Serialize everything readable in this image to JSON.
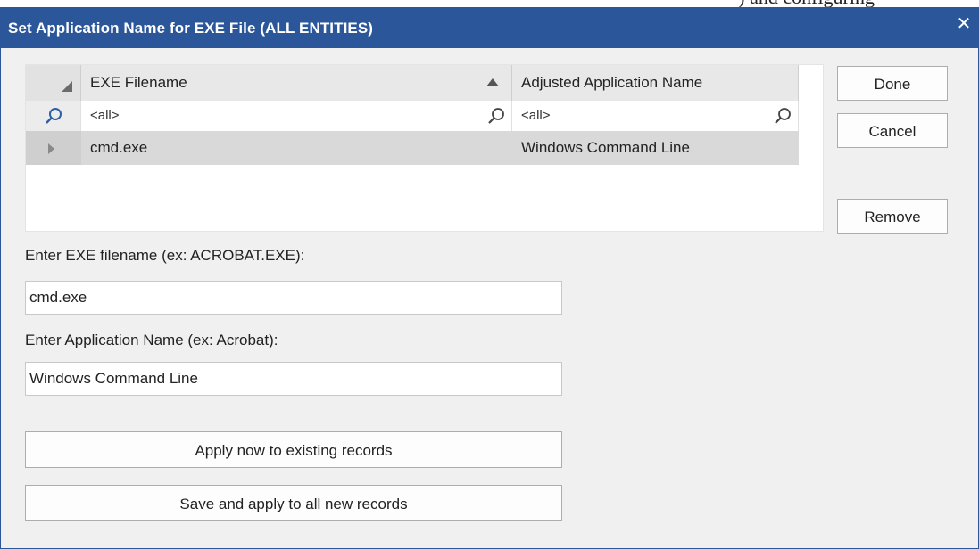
{
  "background_fragment": ") and configuring",
  "titlebar": {
    "title": "Set Application Name for EXE File (ALL ENTITIES)",
    "close_glyph": "✕",
    "color": "#2b579a"
  },
  "grid": {
    "columns": [
      {
        "label": "EXE Filename",
        "sort": "ascending"
      },
      {
        "label": "Adjusted Application Name"
      }
    ],
    "filters": [
      "<all>",
      "<all>"
    ],
    "rows": [
      {
        "exe": "cmd.exe",
        "app_name": "Windows Command Line"
      }
    ]
  },
  "side_buttons": {
    "done": "Done",
    "cancel": "Cancel",
    "remove": "Remove"
  },
  "form": {
    "exe_label": "Enter EXE filename (ex: ACROBAT.EXE):",
    "exe_value": "cmd.exe",
    "app_label": "Enter Application Name (ex: Acrobat):",
    "app_value": "Windows Command Line"
  },
  "actions": {
    "apply_now": "Apply now to existing records",
    "save_apply": "Save and apply to all new records"
  },
  "icons": {
    "filter": "search-icon",
    "sort": "sort-ascending-icon",
    "row_indicator": "row-pointer-icon",
    "close": "close-icon"
  }
}
